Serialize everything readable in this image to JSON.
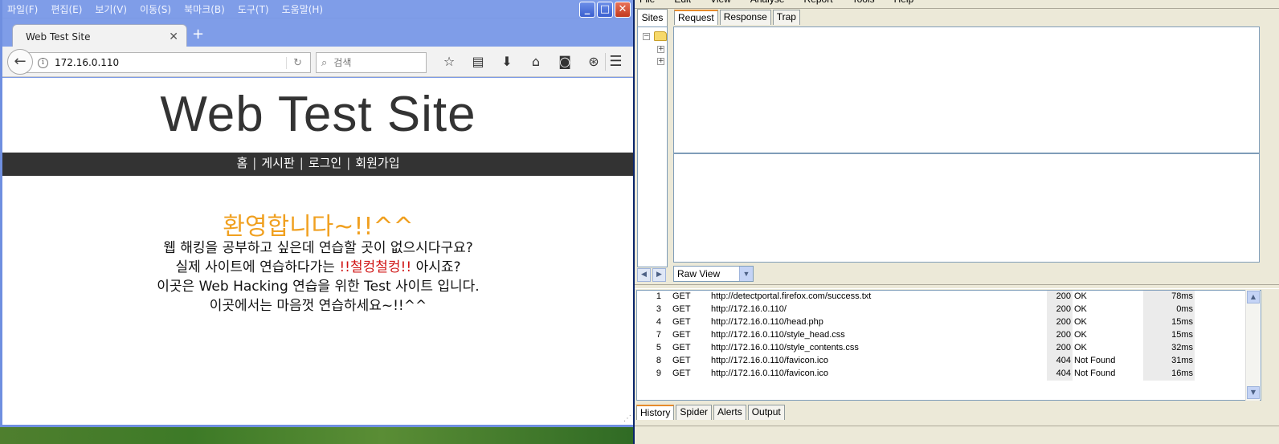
{
  "firefox": {
    "menu": [
      "파일(F)",
      "편집(E)",
      "보기(V)",
      "이동(S)",
      "북마크(B)",
      "도구(T)",
      "도움말(H)"
    ],
    "tab_title": "Web Test Site",
    "url": "172.16.0.110",
    "search_placeholder": "검색"
  },
  "site": {
    "title": "Web Test Site",
    "nav": [
      "홈",
      "게시판",
      "로그인",
      "회원가입"
    ],
    "welcome": "환영합니다~!!^^",
    "line1": "웹 해킹을 공부하고 싶은데 연습할 곳이 없으시다구요?",
    "line2_a": "실제 사이트에 연습하다가는 ",
    "line2_red": "!!철컹철컹!!",
    "line2_b": " 아시죠?",
    "line3": "이곳은 Web Hacking 연습을 위한 Test 사이트 입니다.",
    "line4": "이곳에서는 마음껏 연습하세요~!!^^"
  },
  "paros": {
    "menu": [
      "File",
      "Edit",
      "View",
      "Analyse",
      "Report",
      "Tools",
      "Help"
    ],
    "sites_tab": "Sites",
    "tabs": [
      "Request",
      "Response",
      "Trap"
    ],
    "view_mode": "Raw View",
    "history": [
      {
        "id": "1",
        "method": "GET",
        "url": "http://detectportal.firefox.com/success.txt",
        "status": "200",
        "reason": "OK",
        "time": "78ms"
      },
      {
        "id": "3",
        "method": "GET",
        "url": "http://172.16.0.110/",
        "status": "200",
        "reason": "OK",
        "time": "0ms"
      },
      {
        "id": "4",
        "method": "GET",
        "url": "http://172.16.0.110/head.php",
        "status": "200",
        "reason": "OK",
        "time": "15ms"
      },
      {
        "id": "7",
        "method": "GET",
        "url": "http://172.16.0.110/style_head.css",
        "status": "200",
        "reason": "OK",
        "time": "15ms"
      },
      {
        "id": "5",
        "method": "GET",
        "url": "http://172.16.0.110/style_contents.css",
        "status": "200",
        "reason": "OK",
        "time": "32ms"
      },
      {
        "id": "8",
        "method": "GET",
        "url": "http://172.16.0.110/favicon.ico",
        "status": "404",
        "reason": "Not Found",
        "time": "31ms"
      },
      {
        "id": "9",
        "method": "GET",
        "url": "http://172.16.0.110/favicon.ico",
        "status": "404",
        "reason": "Not Found",
        "time": "16ms"
      }
    ],
    "bottom_tabs": [
      "History",
      "Spider",
      "Alerts",
      "Output"
    ]
  },
  "icons": {
    "back": "back-arrow-icon",
    "info": "info-icon",
    "reload": "reload-icon",
    "search": "search-icon",
    "nav_toolbar": [
      "bookmark-star-icon",
      "reading-list-icon",
      "download-icon",
      "home-icon",
      "pocket-icon",
      "sync-icon"
    ],
    "menu": "hamburger-menu-icon"
  },
  "colors": {
    "welcome": "#f0a020",
    "alert_red": "#d01515",
    "nav_bar": "#333333",
    "xp_titlebar": "#7f9de8"
  }
}
